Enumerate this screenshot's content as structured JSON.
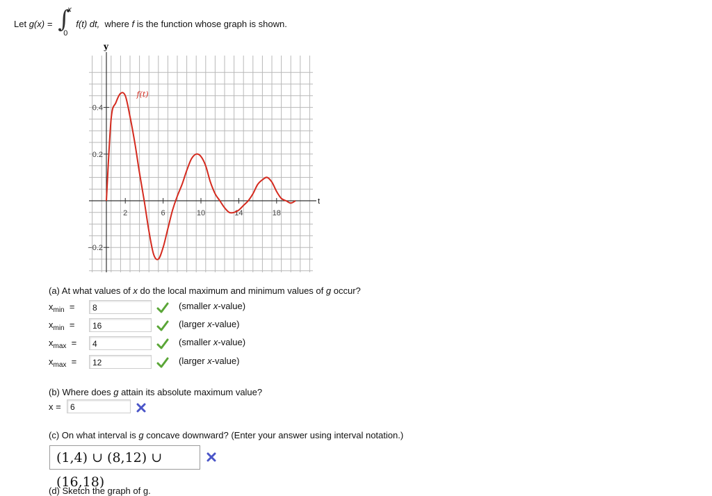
{
  "statement": {
    "prefix": "Let",
    "gx": "g(x) =",
    "upper": "x",
    "lower": "0",
    "integrand": "f(t) dt,",
    "where": "where",
    "f": "f",
    "suffix": "is the function whose graph is shown."
  },
  "graph": {
    "y_axis_label": "y",
    "t_axis_label": "t",
    "curve_label": "f(t)",
    "y_ticks": [
      "0.4",
      "0.2",
      "−0.2"
    ],
    "x_ticks": [
      "2",
      "6",
      "10",
      "14",
      "18"
    ],
    "colors": {
      "curve": "#d42a1e",
      "grid": "#b8b8b8",
      "axis": "#333333"
    },
    "chart_data": {
      "type": "line",
      "xlabel": "t",
      "ylabel": "y",
      "series": [
        {
          "name": "f(t)",
          "x": [
            0,
            0.5,
            1,
            1.5,
            2,
            2.5,
            3,
            3.5,
            4,
            4.5,
            5,
            5.5,
            6,
            6.5,
            7,
            7.5,
            8,
            8.5,
            9,
            9.5,
            10,
            10.5,
            11,
            11.5,
            12,
            12.5,
            13,
            13.5,
            14,
            14.5,
            15,
            15.5,
            16,
            16.5,
            17,
            17.5,
            18,
            18.5,
            19,
            19.5,
            20
          ],
          "y": [
            0,
            0.35,
            0.42,
            0.46,
            0.45,
            0.36,
            0.25,
            0.12,
            0,
            -0.13,
            -0.23,
            -0.25,
            -0.2,
            -0.12,
            -0.04,
            0.02,
            0.07,
            0.13,
            0.18,
            0.2,
            0.19,
            0.15,
            0.08,
            0.03,
            0,
            -0.03,
            -0.05,
            -0.05,
            -0.04,
            -0.02,
            0,
            0.03,
            0.07,
            0.09,
            0.1,
            0.08,
            0.04,
            0.01,
            0,
            -0.01,
            0
          ]
        }
      ],
      "xlim": [
        -2,
        22
      ],
      "ylim": [
        -0.3,
        0.55
      ],
      "grid": true
    }
  },
  "part_a": {
    "question_pre": "(a) At what values of",
    "question_x": "x",
    "question_mid": "do the local maximum and minimum values of",
    "question_g": "g",
    "question_post": "occur?",
    "rows": [
      {
        "label": "x",
        "sub": "min",
        "eq": "=",
        "value": "8",
        "note_pre": "(smaller",
        "note_x": "x",
        "note_post": "-value)"
      },
      {
        "label": "x",
        "sub": "min",
        "eq": "=",
        "value": "16",
        "note_pre": "(larger",
        "note_x": "x",
        "note_post": "-value)"
      },
      {
        "label": "x",
        "sub": "max",
        "eq": "=",
        "value": "4",
        "note_pre": "(smaller",
        "note_x": "x",
        "note_post": "-value)"
      },
      {
        "label": "x",
        "sub": "max",
        "eq": "=",
        "value": "12",
        "note_pre": "(larger",
        "note_x": "x",
        "note_post": "-value)"
      }
    ]
  },
  "part_b": {
    "question_pre": "(b) Where does",
    "question_g": "g",
    "question_post": "attain its absolute maximum value?",
    "label": "x =",
    "value": "6"
  },
  "part_c": {
    "question_pre": "(c) On what interval is",
    "question_g": "g",
    "question_post": "concave downward? (Enter your answer using interval notation.)",
    "value": "(1,4) ∪ (8,12) ∪ (16,18)"
  },
  "part_d": {
    "question": "(d) Sketch the graph of g."
  }
}
